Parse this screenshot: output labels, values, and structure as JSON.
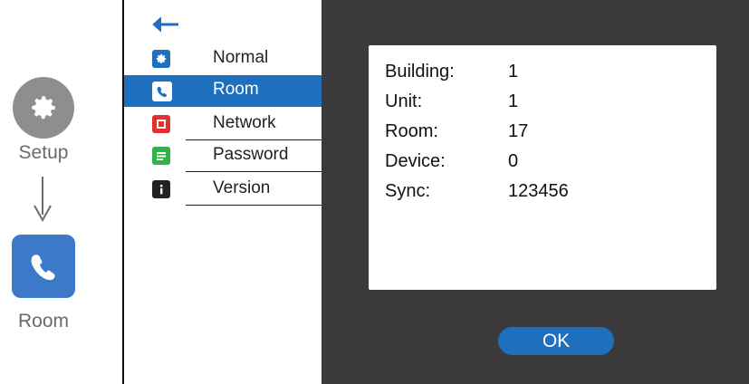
{
  "guide": {
    "setup_label": "Setup",
    "room_label": "Room",
    "setup_icon": "gear-icon",
    "room_icon": "phone-handset-icon"
  },
  "menu": {
    "back_icon": "arrow-left-icon",
    "items": [
      {
        "label": "Normal",
        "icon": "gear-icon",
        "color": "#1f6fbf",
        "active": false
      },
      {
        "label": "Room",
        "icon": "phone-icon",
        "color": "#1f6fbf",
        "active": true
      },
      {
        "label": "Network",
        "icon": "network-icon",
        "color": "#e03030",
        "active": false
      },
      {
        "label": "Password",
        "icon": "password-icon",
        "color": "#2fb34a",
        "active": false
      },
      {
        "label": "Version",
        "icon": "info-icon",
        "color": "#222222",
        "active": false
      }
    ]
  },
  "info": {
    "building_key": "Building:",
    "building_val": "1",
    "unit_key": "Unit:",
    "unit_val": "1",
    "room_key": "Room:",
    "room_val": "17",
    "device_key": "Device:",
    "device_val": "0",
    "sync_key": "Sync:",
    "sync_val": "123456"
  },
  "ok_label": "OK",
  "colors": {
    "accent": "#1f6fbf",
    "dark_bg": "#3a3a3a",
    "guide_gray": "#8e8e8e"
  }
}
